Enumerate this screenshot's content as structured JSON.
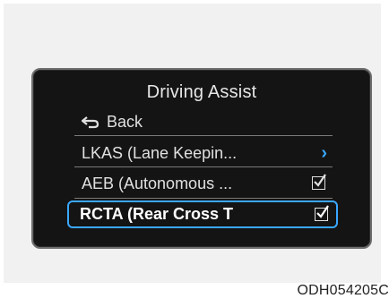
{
  "menu": {
    "title": "Driving Assist",
    "back_label": "Back",
    "items": [
      {
        "label": "LKAS (Lane Keepin...",
        "control": "chevron",
        "chevron_glyph": "›"
      },
      {
        "label": "AEB (Autonomous ...",
        "control": "checkbox",
        "checked": true
      },
      {
        "label": "RCTA (Rear Cross T",
        "control": "checkbox",
        "checked": true,
        "selected": true
      }
    ]
  },
  "footer": {
    "code": "ODH054205C"
  },
  "colors": {
    "screen_bg": "#141414",
    "accent": "#3aa8ff",
    "text": "#e0e0e0"
  }
}
